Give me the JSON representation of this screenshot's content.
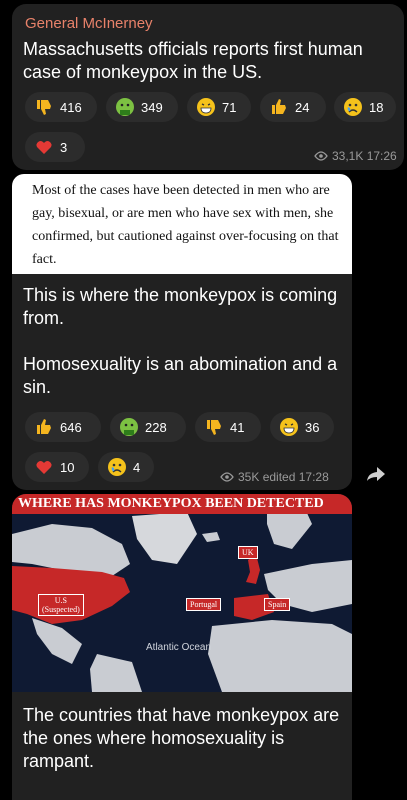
{
  "msg1": {
    "sender": "General McInerney",
    "text": "Massachusetts officials reports first human case of monkeypox in the US.",
    "reactions": [
      {
        "emoji": "thumbs-down-icon",
        "count": "416"
      },
      {
        "emoji": "vomit-face-icon",
        "count": "349"
      },
      {
        "emoji": "grin-face-icon",
        "count": "71"
      },
      {
        "emoji": "thumbs-up-icon",
        "count": "24"
      },
      {
        "emoji": "crying-face-icon",
        "count": "18"
      },
      {
        "emoji": "heart-icon",
        "count": "3"
      }
    ],
    "views": "33,1K",
    "time": "17:26"
  },
  "msg2": {
    "quote": "Most of the cases have been detected in men who are gay, bisexual, or are men who have sex with men, she confirmed, but cautioned against over-focusing on that fact.",
    "text": "This is where the monkeypox is coming from.\n\nHomosexuality is an abomination and a sin.",
    "reactions": [
      {
        "emoji": "thumbs-up-icon",
        "count": "646"
      },
      {
        "emoji": "vomit-face-icon",
        "count": "228"
      },
      {
        "emoji": "thumbs-down-icon",
        "count": "41"
      },
      {
        "emoji": "grin-face-icon",
        "count": "36"
      },
      {
        "emoji": "heart-icon",
        "count": "10"
      },
      {
        "emoji": "crying-face-icon",
        "count": "4"
      }
    ],
    "views": "35K",
    "edited": "edited",
    "time": "17:28"
  },
  "msg3": {
    "map": {
      "title": "WHERE HAS MONKEYPOX BEEN DETECTED",
      "labels": {
        "us": "U.S\n(Suspected)",
        "uk": "UK",
        "portugal": "Portugal",
        "spain": "Spain",
        "ocean": "Atlantic Ocean"
      }
    },
    "text": "The countries that have monkeypox are the ones where homosexuality is rampant."
  },
  "colors": {
    "bubble": "#212121",
    "sender": "#e8826a",
    "accent_red": "#c62828",
    "meta": "#9a9a9a"
  }
}
